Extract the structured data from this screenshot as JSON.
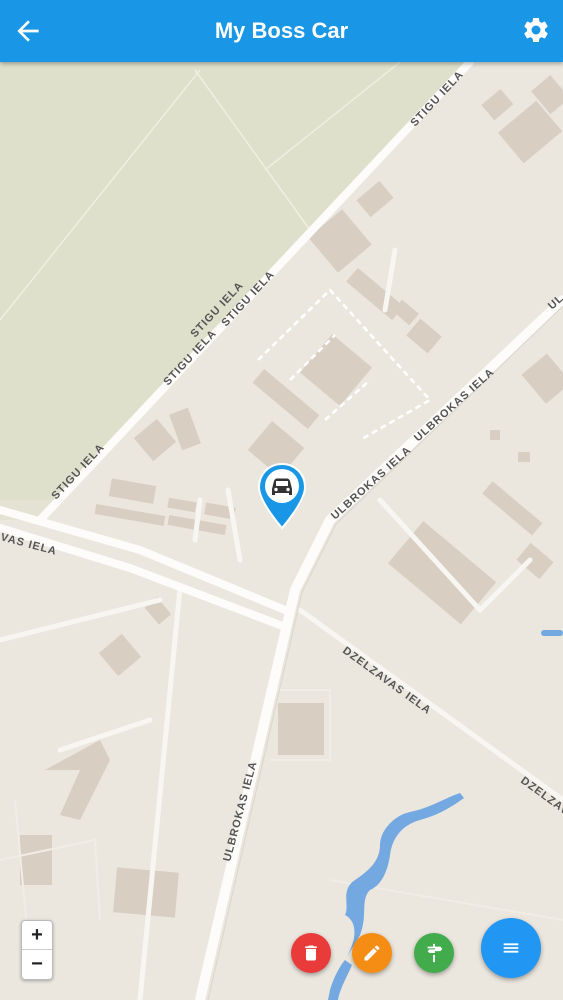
{
  "app": {
    "title": "My Boss Car"
  },
  "icons": {
    "back": "arrow-left-icon",
    "settings": "gear-icon",
    "pin": "car-pin-icon",
    "delete": "trash-icon",
    "edit": "pencil-icon",
    "directions": "signpost-icon",
    "menu": "menu-icon"
  },
  "colors": {
    "appbar": "#1a96e6",
    "fab_delete": "#ea3b3b",
    "fab_edit": "#f58c14",
    "fab_directions": "#42ab4c",
    "fab_menu": "#2196f3"
  },
  "map": {
    "streets": {
      "stigu_1": "STIGU IELA",
      "stigu_2": "STIGU IELA",
      "stigu_3": "STIGU IELA",
      "stigu_4": "STIGU IELA",
      "stigu_5": "STIGU IELA",
      "ulbrokas_1": "ULBROKAS IELA",
      "ulbrokas_2": "ULBROKAS IELA",
      "ulbrokas_3": "ULBROKAS IELA",
      "ulbrokas_4": "UL",
      "dzelzavas_1": "VAS IELA",
      "dzelzavas_2": "DZELZAVAS IELA",
      "dzelzavas_3": "DZELZAV"
    }
  },
  "zoom": {
    "in": "+",
    "out": "−"
  }
}
